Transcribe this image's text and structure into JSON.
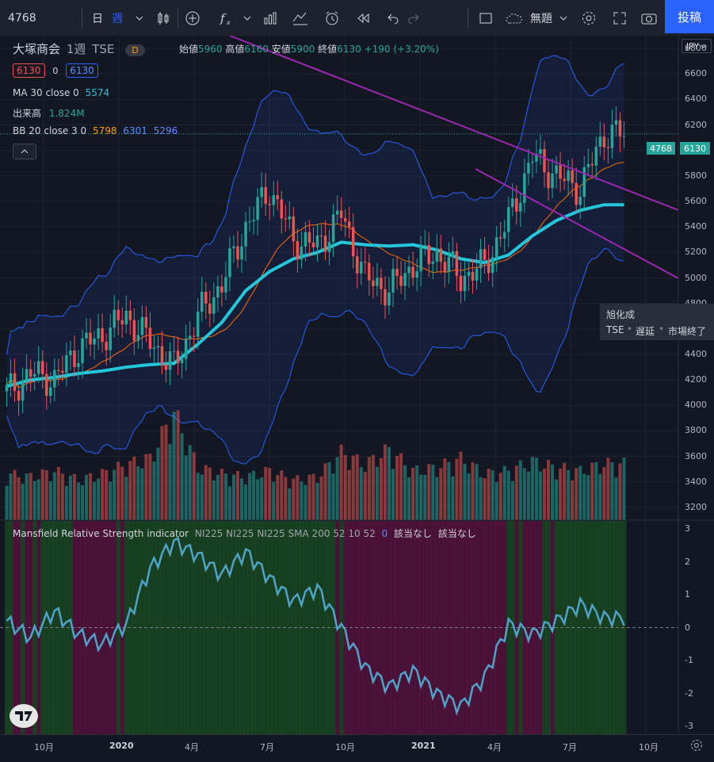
{
  "toolbar": {
    "symbol": "4768",
    "interval_day": "日",
    "interval_week": "週",
    "layout_name": "無題",
    "post_label": "投稿"
  },
  "legend": {
    "name": "大塚商会",
    "interval": "1週",
    "exchange": "TSE",
    "d_badge": "D",
    "open_label": "始値",
    "open": "5960",
    "high_label": "高値",
    "high": "6160",
    "low_label": "安値",
    "low": "5900",
    "close_label": "終値",
    "close": "6130",
    "change": "+190 (+3.20%)",
    "bid": "6130",
    "spread": "0",
    "ask": "6130",
    "ma_label": "MA 30 close 0",
    "ma_value": "5574",
    "vol_label": "出来高",
    "vol_value": "1.824M",
    "bb_label": "BB 20 close 3 0",
    "bb_mid": "5798",
    "bb_up": "6301",
    "bb_low": "5296"
  },
  "price_axis": {
    "currency": "JPY",
    "ticks": [
      "6800",
      "6600",
      "6400",
      "6200",
      "6000",
      "5800",
      "5600",
      "5400",
      "5200",
      "5000",
      "4800",
      "4600",
      "4400",
      "4200",
      "4000",
      "3800",
      "3600",
      "3400",
      "3200"
    ],
    "symbol_tag": "4768",
    "price_tag": "6130"
  },
  "indicator": {
    "name": "Mansfield Relative Strength indicator",
    "params": "NI225 NI225 NI225 SMA 200 52 10 52",
    "value": "0",
    "na1": "該当なし",
    "na2": "該当なし",
    "ticks": [
      "3",
      "2",
      "1",
      "0",
      "-1",
      "-2",
      "-3"
    ]
  },
  "time_axis": [
    "10月",
    "2020",
    "4月",
    "7月",
    "10月",
    "2021",
    "4月",
    "7月",
    "10月"
  ],
  "popup": {
    "title": "旭化成",
    "exchange": "TSE",
    "delay": "遅延",
    "status": "市場終了"
  },
  "colors": {
    "up": "#26a69a",
    "down": "#ef5350",
    "ma": "#26c6da",
    "bb": "#2962ff",
    "trend": "#9c27b0",
    "bbmid": "#ff6d00"
  },
  "chart_data": {
    "type": "candlestick",
    "x": [
      "2019-08",
      "2019-09",
      "2019-10",
      "2019-11",
      "2019-12",
      "2020-01",
      "2020-02",
      "2020-03",
      "2020-04",
      "2020-05",
      "2020-06",
      "2020-07",
      "2020-08",
      "2020-09",
      "2020-10",
      "2020-11",
      "2020-12",
      "2021-01",
      "2021-02",
      "2021-03",
      "2021-04",
      "2021-05",
      "2021-06",
      "2021-07",
      "2021-08",
      "2021-09"
    ],
    "close": [
      4100,
      4250,
      4200,
      4450,
      4550,
      4700,
      4500,
      4300,
      4700,
      4950,
      5400,
      5700,
      5300,
      5250,
      5500,
      5000,
      4900,
      5100,
      5200,
      5000,
      5100,
      5450,
      5950,
      5800,
      5700,
      6130
    ],
    "ma30": [
      4150,
      4200,
      4220,
      4250,
      4270,
      4300,
      4320,
      4330,
      4480,
      4650,
      4900,
      5050,
      5150,
      5200,
      5280,
      5260,
      5250,
      5260,
      5220,
      5150,
      5120,
      5180,
      5330,
      5450,
      5530,
      5574
    ],
    "volume_millions": [
      1.5,
      1.4,
      1.6,
      1.3,
      1.5,
      1.8,
      2.0,
      3.5,
      1.7,
      1.5,
      1.4,
      1.6,
      1.3,
      1.4,
      2.2,
      1.8,
      2.3,
      1.6,
      1.7,
      2.0,
      1.5,
      1.6,
      1.9,
      1.7,
      1.6,
      1.824
    ],
    "mansfield_rs": [
      0.2,
      -0.3,
      0.5,
      -0.2,
      -0.5,
      0.1,
      1.8,
      2.6,
      2.2,
      1.6,
      2.3,
      1.5,
      0.8,
      1.2,
      0.0,
      -1.2,
      -1.8,
      -1.3,
      -2.0,
      -2.4,
      -1.5,
      0.1,
      -0.2,
      0.2,
      0.7,
      0.3
    ],
    "ylim": [
      3100,
      6900
    ],
    "rs_ylim": [
      -3,
      3
    ]
  }
}
